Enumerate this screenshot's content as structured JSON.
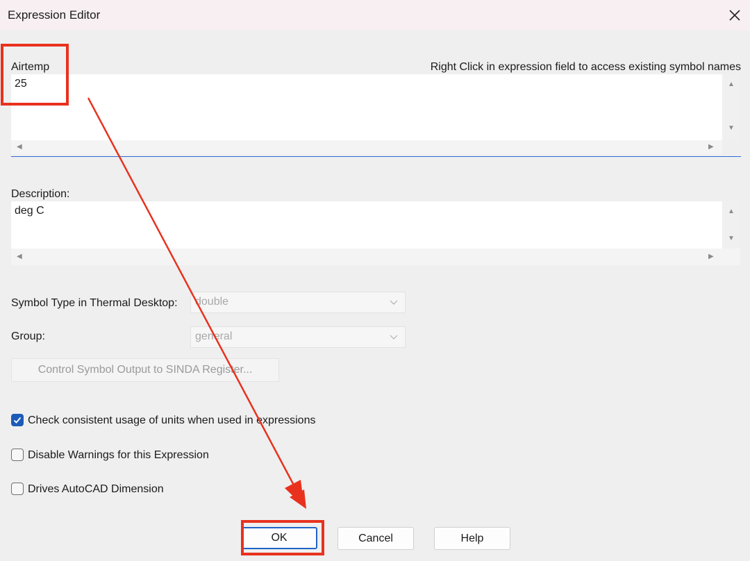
{
  "window": {
    "title": "Expression Editor",
    "close_glyph": "✕"
  },
  "expression": {
    "symbol_name": "Airtemp",
    "hint": "Right Click in expression field to access existing symbol names",
    "value": "25"
  },
  "description": {
    "label": "Description:",
    "value": "deg C"
  },
  "symbol_type": {
    "label": "Symbol Type in Thermal Desktop:",
    "selected": "double"
  },
  "group": {
    "label": "Group:",
    "selected": "general"
  },
  "sinda_button_label": "Control Symbol Output to SINDA Register...",
  "checkboxes": [
    {
      "label": "Check consistent usage of units when used in expressions",
      "checked": true
    },
    {
      "label": "Disable Warnings for this Expression",
      "checked": false
    },
    {
      "label": "Drives AutoCAD Dimension",
      "checked": false
    }
  ],
  "buttons": {
    "ok": "OK",
    "cancel": "Cancel",
    "help": "Help"
  },
  "icons": {
    "close": "close-icon",
    "scroll_up": "scroll-up-arrow-icon",
    "scroll_down": "scroll-down-arrow-icon",
    "scroll_left": "scroll-left-arrow-icon",
    "scroll_right": "scroll-right-arrow-icon",
    "chevron": "chevron-down-icon",
    "check": "checkmark-icon"
  },
  "colors": {
    "annotation_red": "#e8321e",
    "accent_blue": "#1e5bb8"
  }
}
